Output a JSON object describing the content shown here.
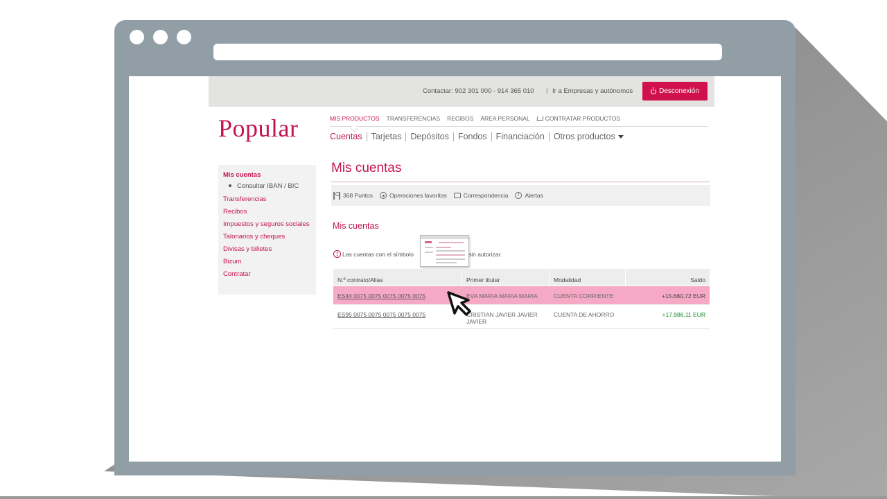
{
  "topbar": {
    "contact": "Contactar: 902 301 000 - 914 365 010",
    "separator": "|",
    "empresas_link": "Ir a Empresas y autónomos",
    "logout_label": "Desconexión"
  },
  "logo": "Popular",
  "main_nav": {
    "items": [
      "MIS PRODUCTOS",
      "TRANSFERENCIAS",
      "RECIBOS",
      "ÁREA PERSONAL",
      "CONTRATAR PRODUCTOS"
    ],
    "active_index": 0
  },
  "sub_nav": {
    "items": [
      "Cuentas",
      "Tarjetas",
      "Depósitos",
      "Fondos",
      "Financiación",
      "Otros productos"
    ]
  },
  "sidebar": {
    "title": "Mis cuentas",
    "sub_item": "Consultar IBAN / BIC",
    "links": [
      "Transferencias",
      "Recibos",
      "Impuestos y seguros sociales",
      "Talonarios y cheques",
      "Divisas y billetes",
      "Bizum",
      "Contratar"
    ]
  },
  "page_title": "Mis cuentas",
  "tools": {
    "points": "368 Puntos",
    "favorites": "Operaciones favoritas",
    "mail": "Correspondencia",
    "alerts": "Alertas"
  },
  "section_title": "Mis cuentas",
  "notice": {
    "part1": "Las cuentas con el símbolo",
    "part2": "sin autorizar."
  },
  "table": {
    "headers": [
      "N.º contrato/Alias",
      "Primer titular",
      "Modalidad",
      "Saldo"
    ],
    "rows": [
      {
        "account": "ES44 0075 0075 0075 0075 0075",
        "holder": "EVA MARIA MARIA MARIA",
        "type": "CUENTA CORRIENTE",
        "balance": "+15.680,72  EUR"
      },
      {
        "account": "ES95 0075 0075 0075 0075 0075",
        "holder": "CRISTIAN JAVIER JAVIER JAVIER",
        "type": "CUENTA DE AHORRO",
        "balance": "+17.986,11  EUR"
      }
    ]
  },
  "colors": {
    "brand": "#c41250",
    "highlight_row": "#f6a9c4",
    "positive": "#1a8a2a"
  }
}
